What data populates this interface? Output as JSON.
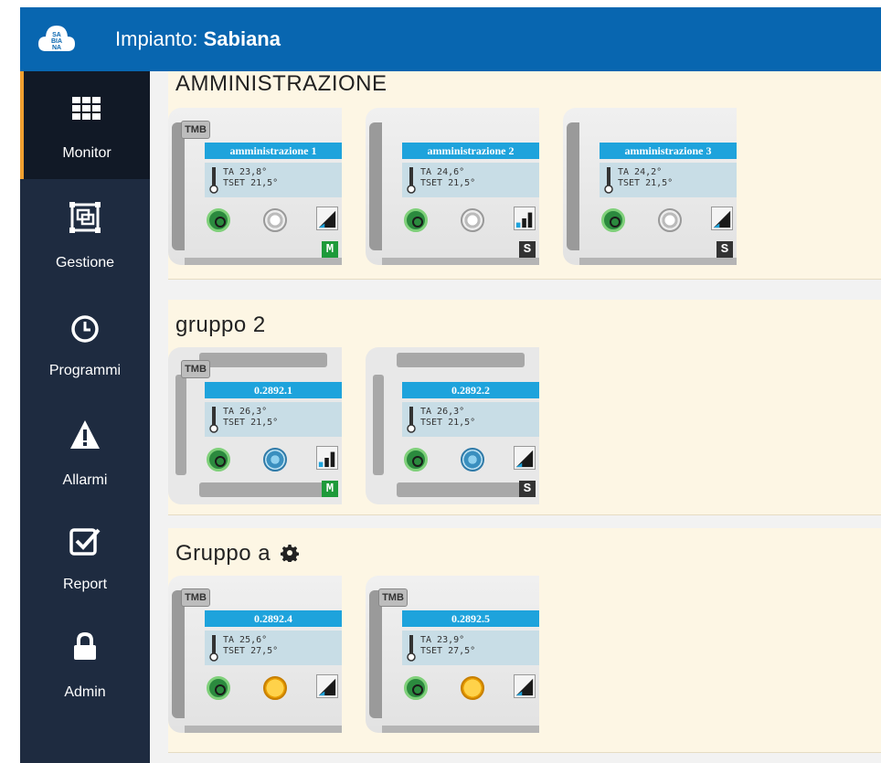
{
  "header": {
    "app_title_prefix": "Impianto: ",
    "app_title_name": "Sabiana",
    "logo_text": "SA BIA NA",
    "logo_icon": "cloud-logo-icon",
    "color": "#0866b0"
  },
  "sidebar": {
    "items": [
      {
        "label": "Monitor",
        "icon": "grid-icon",
        "active": true
      },
      {
        "label": "Gestione",
        "icon": "gestione-icon",
        "active": false
      },
      {
        "label": "Programmi",
        "icon": "clock-icon",
        "active": false
      },
      {
        "label": "Allarmi",
        "icon": "warning-icon",
        "active": false
      },
      {
        "label": "Report",
        "icon": "check-square-icon",
        "active": false
      },
      {
        "label": "Admin",
        "icon": "lock-icon",
        "active": false
      }
    ],
    "active_color": "#f0a030"
  },
  "groups": [
    {
      "title": "AMMINISTRAZIONE",
      "devices": [
        {
          "tag": "TMB",
          "name": "amministrazione 1",
          "ta": "TA   23,8°",
          "tset": "TSET 21,5°",
          "mode": "white",
          "fan": "ramp",
          "badge": "M"
        },
        {
          "tag": "",
          "name": "amministrazione 2",
          "ta": "TA   24,6°",
          "tset": "TSET 21,5°",
          "mode": "white",
          "fan": "bars",
          "badge": "S"
        },
        {
          "tag": "",
          "name": "amministrazione 3",
          "ta": "TA   24,2°",
          "tset": "TSET 21,5°",
          "mode": "white",
          "fan": "ramp",
          "badge": "S"
        }
      ]
    },
    {
      "title": "gruppo 2",
      "devices": [
        {
          "tag": "TMB",
          "name": "0.2892.1",
          "ta": "TA   26,3°",
          "tset": "TSET 21,5°",
          "mode": "blue",
          "fan": "bars",
          "badge": "M"
        },
        {
          "tag": "",
          "name": "0.2892.2",
          "ta": "TA   26,3°",
          "tset": "TSET 21,5°",
          "mode": "blue",
          "fan": "ramp",
          "badge": "S"
        }
      ]
    },
    {
      "title": "Gruppo a",
      "settings_icon": "gear-icon",
      "devices": [
        {
          "tag": "TMB",
          "name": "0.2892.4",
          "ta": "TA   25,6°",
          "tset": "TSET 27,5°",
          "mode": "yellow",
          "fan": "ramp",
          "badge": ""
        },
        {
          "tag": "TMB",
          "name": "0.2892.5",
          "ta": "TA   23,9°",
          "tset": "TSET 27,5°",
          "mode": "yellow",
          "fan": "ramp",
          "badge": ""
        }
      ]
    }
  ]
}
